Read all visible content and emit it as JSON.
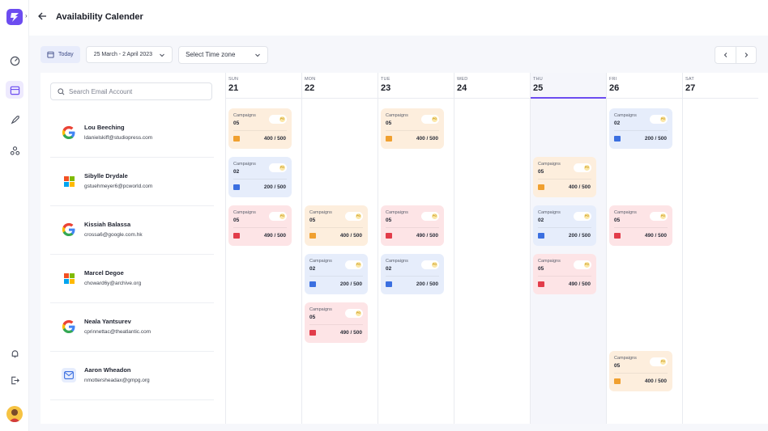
{
  "header": {
    "title": "Availability Calender"
  },
  "toolbar": {
    "today_label": "Today",
    "date_range": "25 March - 2 April 2023",
    "timezone_label": "Select Time zone"
  },
  "search": {
    "placeholder": "Search Email Account"
  },
  "accounts": [
    {
      "name": "Lou Beeching",
      "email": "ldanielskiff@studiopress.com",
      "provider": "google"
    },
    {
      "name": "Sibylle Drydale",
      "email": "gstuehmeyer6@pcworld.com",
      "provider": "microsoft"
    },
    {
      "name": "Kissiah Balassa",
      "email": "crossa6@google.com.hk",
      "provider": "google"
    },
    {
      "name": "Marcel Degoe",
      "email": "choward6y@archive.org",
      "provider": "microsoft"
    },
    {
      "name": "Neala Yantsurev",
      "email": "cprinnettac@theatlantic.com",
      "provider": "google"
    },
    {
      "name": "Aaron Wheadon",
      "email": "nmottersheadax@gmpg.org",
      "provider": "mail"
    }
  ],
  "days": [
    {
      "dow": "SUN",
      "num": "21",
      "today": false
    },
    {
      "dow": "MON",
      "num": "22",
      "today": false
    },
    {
      "dow": "TUE",
      "num": "23",
      "today": false
    },
    {
      "dow": "WED",
      "num": "24",
      "today": false
    },
    {
      "dow": "THU",
      "num": "25",
      "today": true
    },
    {
      "dow": "FRI",
      "num": "26",
      "today": false
    },
    {
      "dow": "SAT",
      "num": "27",
      "today": false
    }
  ],
  "card_label": "Campaigns",
  "toggle_label": "PG",
  "cards": [
    {
      "day": 0,
      "row": 0,
      "color": "orange",
      "count": "05",
      "value": "400 / 500"
    },
    {
      "day": 0,
      "row": 1,
      "color": "blue",
      "count": "02",
      "value": "200 / 500"
    },
    {
      "day": 0,
      "row": 2,
      "color": "pink",
      "count": "05",
      "value": "490 / 500"
    },
    {
      "day": 1,
      "row": 2,
      "color": "orange",
      "count": "05",
      "value": "400 / 500"
    },
    {
      "day": 1,
      "row": 3,
      "color": "blue",
      "count": "02",
      "value": "200 / 500"
    },
    {
      "day": 1,
      "row": 4,
      "color": "pink",
      "count": "05",
      "value": "490 / 500"
    },
    {
      "day": 2,
      "row": 0,
      "color": "orange",
      "count": "05",
      "value": "400 / 500"
    },
    {
      "day": 2,
      "row": 2,
      "color": "pink",
      "count": "05",
      "value": "490 / 500"
    },
    {
      "day": 2,
      "row": 3,
      "color": "blue",
      "count": "02",
      "value": "200 / 500"
    },
    {
      "day": 4,
      "row": 1,
      "color": "orange",
      "count": "05",
      "value": "400 / 500"
    },
    {
      "day": 4,
      "row": 2,
      "color": "blue",
      "count": "02",
      "value": "200 / 500"
    },
    {
      "day": 4,
      "row": 3,
      "color": "pink",
      "count": "05",
      "value": "490 / 500"
    },
    {
      "day": 5,
      "row": 0,
      "color": "blue",
      "count": "02",
      "value": "200 / 500"
    },
    {
      "day": 5,
      "row": 2,
      "color": "pink",
      "count": "05",
      "value": "490 / 500"
    },
    {
      "day": 5,
      "row": 5,
      "color": "orange",
      "count": "05",
      "value": "400 / 500"
    }
  ],
  "colors": {
    "accent": "#6c4cf0",
    "orange_card": "#fdeedd",
    "blue_card": "#e6edfb",
    "pink_card": "#fde4e6"
  },
  "icons": {
    "rail": [
      "dashboard-icon",
      "calendar-icon",
      "rocket-icon",
      "people-icon",
      "bell-icon",
      "logout-icon"
    ]
  }
}
